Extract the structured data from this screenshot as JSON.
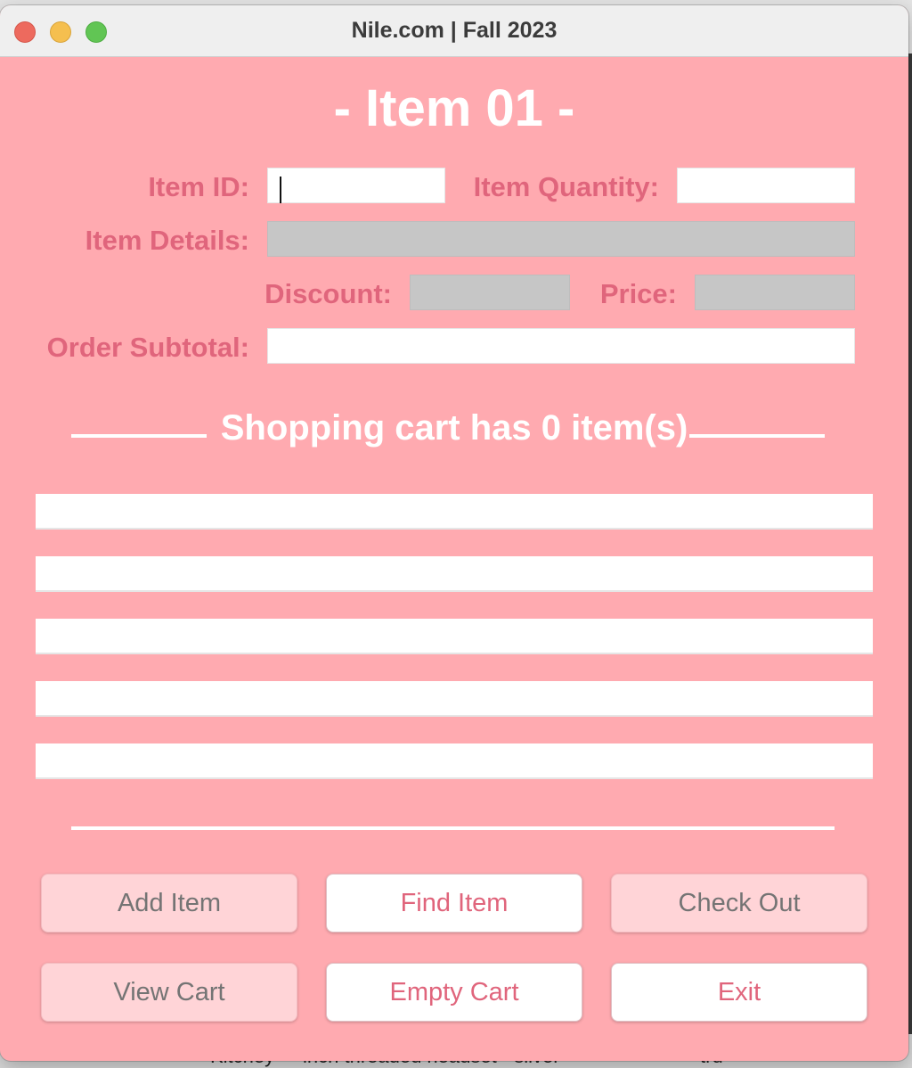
{
  "window": {
    "title": "Nile.com | Fall 2023"
  },
  "main": {
    "heading": "- Item 01 -",
    "item_id_label": "Item ID:",
    "item_id_value": "",
    "item_quantity_label": "Item Quantity:",
    "item_quantity_value": "",
    "item_details_label": "Item Details:",
    "item_details_value": "",
    "discount_label": "Discount:",
    "discount_value": "",
    "price_label": "Price:",
    "price_value": "",
    "order_subtotal_label": "Order Subtotal:",
    "order_subtotal_value": ""
  },
  "cart": {
    "title": "Shopping cart has 0 item(s)",
    "rows": [
      "",
      "",
      "",
      "",
      ""
    ]
  },
  "buttons": {
    "add_item": "Add Item",
    "find_item": "Find Item",
    "check_out": "Check Out",
    "view_cart": "View Cart",
    "empty_cart": "Empty Cart",
    "exit": "Exit"
  },
  "background": {
    "fragment_left": "Kitchey",
    "fragment_mid": "inch threaded headset - silver",
    "fragment_right": "tru"
  },
  "colors": {
    "window_bg": "#ffaab0",
    "label": "#e0657c",
    "heading": "#ffffff",
    "disabled_field": "#c6c6c6",
    "button_active_text": "#e0657c",
    "button_inactive_bg": "#ffd4d7",
    "button_inactive_text": "#747474"
  }
}
